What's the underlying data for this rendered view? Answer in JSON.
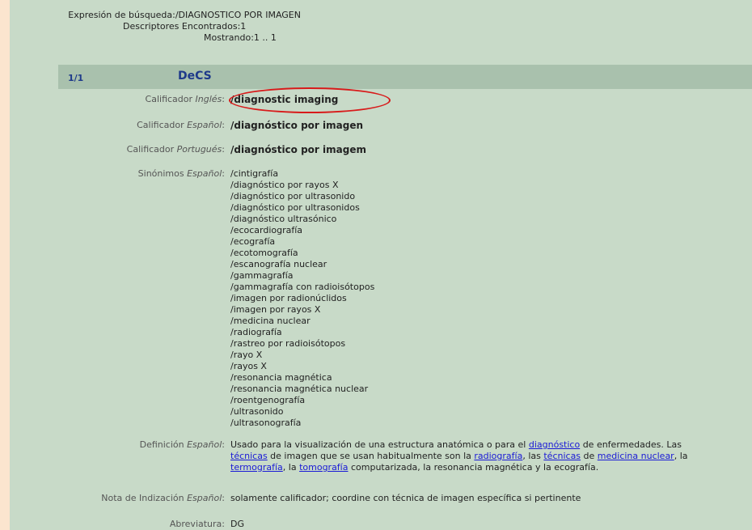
{
  "search": {
    "expression_label": "Expresión de búsqueda:",
    "expression_value": "/DIAGNOSTICO POR IMAGEN",
    "found_label": "Descriptores Encontrados:",
    "found_value": "1",
    "showing_label": "Mostrando:",
    "showing_value": "1 .. 1"
  },
  "record": {
    "count": "1/1",
    "title": "DeCS",
    "ingles": {
      "label": "Calificador ",
      "label_italic": "Inglés",
      "label_suffix": ":",
      "value": "/diagnostic imaging"
    },
    "espanol": {
      "label": "Calificador ",
      "label_italic": "Español",
      "label_suffix": ":",
      "value": "/diagnóstico por imagen"
    },
    "portugues": {
      "label": "Calificador ",
      "label_italic": "Portugués",
      "label_suffix": ":",
      "value": "/diagnóstico por imagem"
    },
    "sinonimos": {
      "label": "Sinónimos ",
      "label_italic": "Español",
      "label_suffix": ":",
      "items": [
        "/cintigrafía",
        "/diagnóstico por rayos X",
        "/diagnóstico por ultrasonido",
        "/diagnóstico por ultrasonidos",
        "/diagnóstico ultrasónico",
        "/ecocardiografía",
        "/ecografía",
        "/ecotomografía",
        "/escanografía nuclear",
        "/gammagrafía",
        "/gammagrafía con radioisótopos",
        "/imagen por radionúclidos",
        "/imagen por rayos X",
        "/medicina nuclear",
        "/radiografía",
        "/rastreo por radioisótopos",
        "/rayo X",
        "/rayos X",
        "/resonancia magnética",
        "/resonancia magnética nuclear",
        "/roentgenografía",
        "/ultrasonido",
        "/ultrasonografía"
      ]
    },
    "definicion": {
      "label": "Definición ",
      "label_italic": "Español",
      "label_suffix": ":",
      "t1": "Usado para la visualización de una estructura anatómica o para el ",
      "l1": "diagnóstico",
      "t2": " de enfermedades. Las ",
      "l2": "técnicas",
      "t3": " de imagen que se usan habitualmente son la ",
      "l3": "radiografía",
      "t4": ", las ",
      "l4": "técnicas",
      "t5": " de ",
      "l5": "medicina nuclear",
      "t6": ", la ",
      "l6": "termografía",
      "t7": ", la ",
      "l7": "tomografía",
      "t8": " computarizada, la resonancia magnética y la ecografía."
    },
    "nota": {
      "label": "Nota de Indización ",
      "label_italic": "Español",
      "label_suffix": ":",
      "value": "solamente calificador; coordine con técnica de imagen específica si pertinente"
    },
    "abreviatura": {
      "label": "Abreviatura:",
      "value": "DG"
    }
  },
  "colors": {
    "highlight": "#d81a1a",
    "link": "#1a1ad6",
    "header": "#a9c1ad",
    "background": "#c8dac8"
  }
}
